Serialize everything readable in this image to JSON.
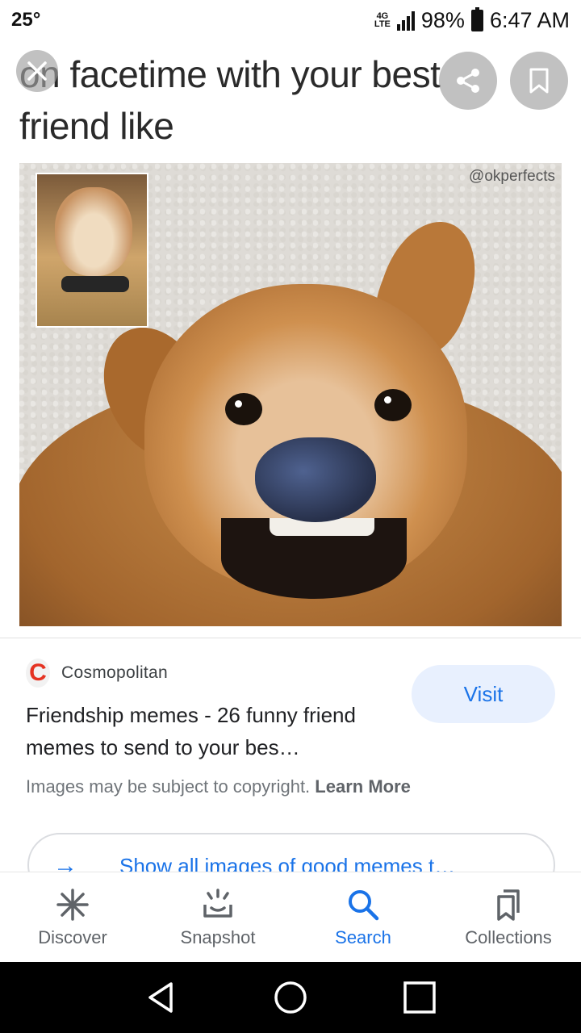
{
  "status_bar": {
    "temperature": "25°",
    "network": "4G",
    "network_sub": "LTE",
    "battery": "98%",
    "time": "6:47 AM"
  },
  "meme": {
    "caption": "on facetime with your best friend like",
    "watermark": "@okperfects"
  },
  "overlay": {
    "close_icon": "close-icon",
    "share_icon": "share-icon",
    "bookmark_icon": "bookmark-icon"
  },
  "result": {
    "source_logo": "C",
    "source_name": "Cosmopolitan",
    "title": "Friendship memes - 26 funny friend memes to send to your bes…",
    "visit_label": "Visit",
    "copyright_text": "Images may be subject to copyright.",
    "learn_more": "Learn More",
    "show_all_label": "Show all images of good memes t…"
  },
  "bottom_nav": {
    "items": [
      {
        "label": "Discover",
        "icon": "asterisk-icon"
      },
      {
        "label": "Snapshot",
        "icon": "snapshot-icon"
      },
      {
        "label": "Search",
        "icon": "search-icon"
      },
      {
        "label": "Collections",
        "icon": "collections-icon"
      }
    ],
    "active": "Search"
  },
  "colors": {
    "accent": "#1a73e8",
    "visit_bg": "#e8f0fe",
    "logo_red": "#e53322"
  }
}
